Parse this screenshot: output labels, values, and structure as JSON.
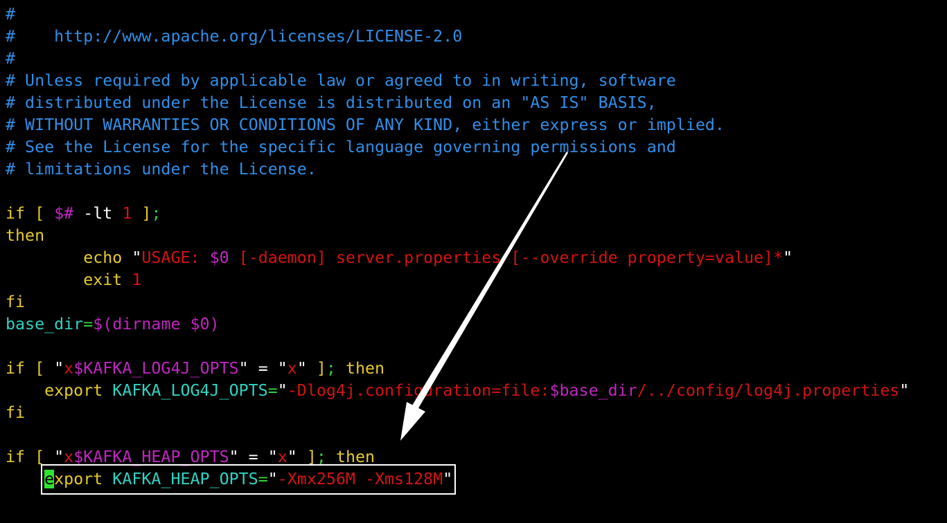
{
  "lines": [
    {
      "segments": [
        {
          "text": "#",
          "cls": "c-comment"
        }
      ]
    },
    {
      "segments": [
        {
          "text": "#    http://www.apache.org/licenses/LICENSE-2.0",
          "cls": "c-comment"
        }
      ]
    },
    {
      "segments": [
        {
          "text": "#",
          "cls": "c-comment"
        }
      ]
    },
    {
      "segments": [
        {
          "text": "# Unless required by applicable law or agreed to in writing, software",
          "cls": "c-comment"
        }
      ]
    },
    {
      "segments": [
        {
          "text": "# distributed under the License is distributed on an \"AS IS\" BASIS,",
          "cls": "c-comment"
        }
      ]
    },
    {
      "segments": [
        {
          "text": "# WITHOUT WARRANTIES OR CONDITIONS OF ANY KIND, either express or implied.",
          "cls": "c-comment"
        }
      ]
    },
    {
      "segments": [
        {
          "text": "# See the License for the specific language governing permissions and",
          "cls": "c-comment"
        }
      ]
    },
    {
      "segments": [
        {
          "text": "# limitations under the License.",
          "cls": "c-comment"
        }
      ]
    },
    {
      "segments": []
    },
    {
      "segments": [
        {
          "text": "if",
          "cls": "c-kw"
        },
        {
          "text": " [ ",
          "cls": "c-kw"
        },
        {
          "text": "$#",
          "cls": "c-var"
        },
        {
          "text": " -lt ",
          "cls": "c-white"
        },
        {
          "text": "1",
          "cls": "c-num"
        },
        {
          "text": " ]",
          "cls": "c-kw"
        },
        {
          "text": ";",
          "cls": "c-green"
        }
      ]
    },
    {
      "segments": [
        {
          "text": "then",
          "cls": "c-kw"
        }
      ]
    },
    {
      "segments": [
        {
          "text": "        echo ",
          "cls": "c-kw"
        },
        {
          "text": "\"",
          "cls": "c-white"
        },
        {
          "text": "USAGE: ",
          "cls": "c-str"
        },
        {
          "text": "$0",
          "cls": "c-var"
        },
        {
          "text": " [-daemon] server.properties [--override property=value]*",
          "cls": "c-str"
        },
        {
          "text": "\"",
          "cls": "c-white"
        }
      ]
    },
    {
      "segments": [
        {
          "text": "        exit ",
          "cls": "c-kw"
        },
        {
          "text": "1",
          "cls": "c-num"
        }
      ]
    },
    {
      "segments": [
        {
          "text": "fi",
          "cls": "c-kw"
        }
      ]
    },
    {
      "segments": [
        {
          "text": "base_dir",
          "cls": "c-cyan"
        },
        {
          "text": "=",
          "cls": "c-green"
        },
        {
          "text": "$(",
          "cls": "c-var"
        },
        {
          "text": "dirname ",
          "cls": "c-var"
        },
        {
          "text": "$0",
          "cls": "c-var"
        },
        {
          "text": ")",
          "cls": "c-var"
        }
      ]
    },
    {
      "segments": []
    },
    {
      "segments": [
        {
          "text": "if",
          "cls": "c-kw"
        },
        {
          "text": " [ ",
          "cls": "c-kw"
        },
        {
          "text": "\"",
          "cls": "c-white"
        },
        {
          "text": "x",
          "cls": "c-str"
        },
        {
          "text": "$KAFKA_LOG4J_OPTS",
          "cls": "c-var"
        },
        {
          "text": "\"",
          "cls": "c-white"
        },
        {
          "text": " = ",
          "cls": "c-white"
        },
        {
          "text": "\"",
          "cls": "c-white"
        },
        {
          "text": "x",
          "cls": "c-str"
        },
        {
          "text": "\"",
          "cls": "c-white"
        },
        {
          "text": " ]",
          "cls": "c-kw"
        },
        {
          "text": ";",
          "cls": "c-green"
        },
        {
          "text": " then",
          "cls": "c-kw"
        }
      ]
    },
    {
      "segments": [
        {
          "text": "    export ",
          "cls": "c-kw"
        },
        {
          "text": "KAFKA_LOG4J_OPTS",
          "cls": "c-cyan"
        },
        {
          "text": "=",
          "cls": "c-green"
        },
        {
          "text": "\"",
          "cls": "c-white"
        },
        {
          "text": "-Dlog4j.configuration=file:",
          "cls": "c-str"
        },
        {
          "text": "$base_dir",
          "cls": "c-var"
        },
        {
          "text": "/../config/log4j.properties",
          "cls": "c-str"
        },
        {
          "text": "\"",
          "cls": "c-white"
        }
      ]
    },
    {
      "segments": [
        {
          "text": "fi",
          "cls": "c-kw"
        }
      ]
    },
    {
      "segments": []
    },
    {
      "segments": [
        {
          "text": "if",
          "cls": "c-kw"
        },
        {
          "text": " [ ",
          "cls": "c-kw"
        },
        {
          "text": "\"",
          "cls": "c-white"
        },
        {
          "text": "x",
          "cls": "c-str"
        },
        {
          "text": "$KAFKA_HEAP_OPTS",
          "cls": "c-var"
        },
        {
          "text": "\"",
          "cls": "c-white"
        },
        {
          "text": " = ",
          "cls": "c-white"
        },
        {
          "text": "\"",
          "cls": "c-white"
        },
        {
          "text": "x",
          "cls": "c-str"
        },
        {
          "text": "\"",
          "cls": "c-white"
        },
        {
          "text": " ]",
          "cls": "c-kw"
        },
        {
          "text": ";",
          "cls": "c-green"
        },
        {
          "text": " then",
          "cls": "c-kw"
        }
      ]
    },
    {
      "segments": [
        {
          "text": "    ",
          "cls": "c-kw"
        },
        {
          "text": "e",
          "cls": "cursor"
        },
        {
          "text": "xport ",
          "cls": "c-kw"
        },
        {
          "text": "KAFKA_HEAP_OPTS",
          "cls": "c-cyan"
        },
        {
          "text": "=",
          "cls": "c-green"
        },
        {
          "text": "\"",
          "cls": "c-white"
        },
        {
          "text": "-Xmx256M -Xms128M",
          "cls": "c-str"
        },
        {
          "text": "\"",
          "cls": "c-white"
        }
      ]
    }
  ],
  "colors": {
    "background": "#000000",
    "comment": "#2f8fe8",
    "keyword": "#e6cb2f",
    "variable": "#c026c0",
    "string": "#d41313",
    "cyan": "#2fd3c3",
    "cursor": "#31e331",
    "annotation": "#ffffff"
  }
}
